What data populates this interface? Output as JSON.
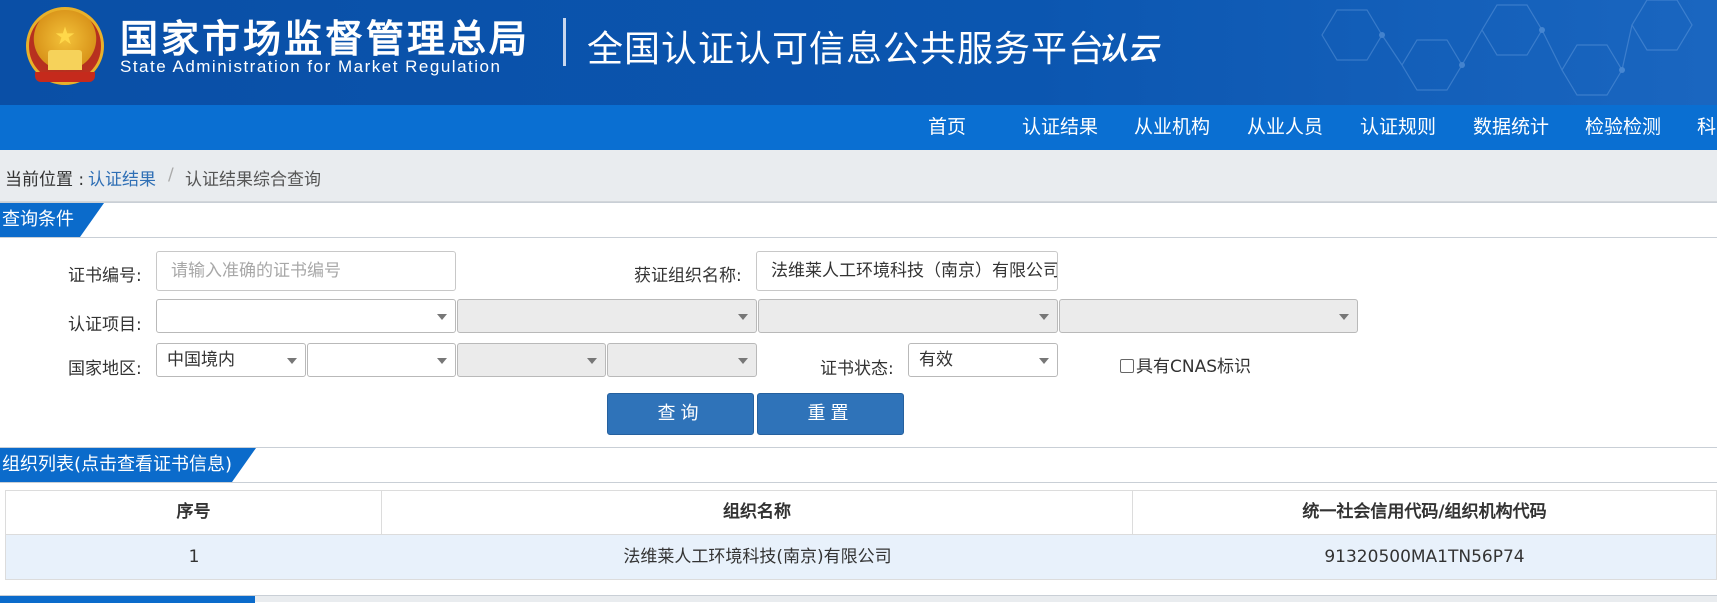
{
  "header": {
    "agency_cn": "国家市场监督管理总局",
    "agency_en": "State Administration  for  Market Regulation",
    "platform_title": "全国认证认可信息公共服务平台",
    "platform_logo": "认云"
  },
  "nav": {
    "items": [
      "首页",
      "认证结果",
      "从业机构",
      "从业人员",
      "认证规则",
      "数据统计",
      "检验检测",
      "科"
    ]
  },
  "breadcrumb": {
    "prefix": "当前位置 :",
    "link": "认证结果",
    "separator": "/",
    "current": "认证结果综合查询"
  },
  "query": {
    "section_title": "查询条件",
    "cert_no_label": "证书编号:",
    "cert_no_placeholder": "请输入准确的证书编号",
    "org_name_label": "获证组织名称:",
    "org_name_value": "法维莱人工环境科技（南京）有限公司",
    "project_label": "认证项目:",
    "project_selects": [
      "",
      "",
      "",
      ""
    ],
    "region_label": "国家地区:",
    "region_selects": [
      "中国境内",
      "",
      "",
      ""
    ],
    "status_label": "证书状态:",
    "status_value": "有效",
    "cnas_label": "具有CNAS标识",
    "search_button": "查询",
    "reset_button": "重置"
  },
  "results": {
    "section_title": "组织列表(点击查看证书信息)",
    "columns": [
      "序号",
      "组织名称",
      "统一社会信用代码/组织机构代码"
    ],
    "rows": [
      {
        "index": "1",
        "org_name": "法维莱人工环境科技(南京)有限公司",
        "credit_code": "91320500MA1TN56P74"
      }
    ]
  },
  "colors": {
    "banner": "#0b56b0",
    "navbar": "#0a6fd2",
    "button": "#2f73b9",
    "link": "#2f6fb5",
    "row_highlight": "#e8f1fb"
  }
}
